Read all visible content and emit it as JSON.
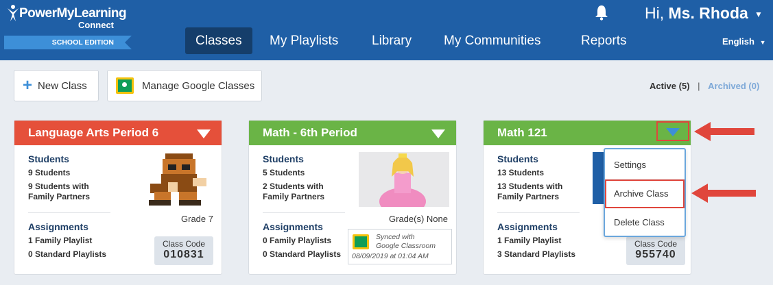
{
  "header": {
    "logo_text": "PowerMyLearning",
    "logo_sub": "Connect",
    "logo_banner": "SCHOOL EDITION",
    "greeting_prefix": "Hi, ",
    "greeting_name": "Ms. Rhoda",
    "language": "English",
    "nav": [
      {
        "label": "Classes",
        "active": true
      },
      {
        "label": "My Playlists"
      },
      {
        "label": "Library"
      },
      {
        "label": "My Communities"
      },
      {
        "label": "Reports"
      }
    ]
  },
  "toolbar": {
    "new_class_label": "New Class",
    "manage_google_label": "Manage Google Classes",
    "filter_active": "Active (5)",
    "filter_sep": "|",
    "filter_archived": "Archived (0)"
  },
  "cards": [
    {
      "title": "Language Arts Period 6",
      "students_heading": "Students",
      "students_count": "9 Students",
      "family_line1": "9 Students with",
      "family_line2": "Family Partners",
      "grade": "Grade 7",
      "assignments_heading": "Assignments",
      "assign1": "1 Family Playlist",
      "assign2": "0 Standard Playlists",
      "code_label": "Class Code",
      "code": "010831"
    },
    {
      "title": "Math - 6th Period",
      "students_heading": "Students",
      "students_count": "5 Students",
      "family_line1": "2 Students with",
      "family_line2": "Family Partners",
      "grade": "Grade(s) None",
      "assignments_heading": "Assignments",
      "assign1": "0 Family Playlists",
      "assign2": "0 Standard Playlists",
      "sync_line1": "Synced with",
      "sync_line2": "Google Classroom",
      "sync_date": "08/09/2019 at 01:04 AM"
    },
    {
      "title": "Math 121",
      "students_heading": "Students",
      "students_count": "13 Students",
      "family_line1": "13 Students with",
      "family_line2": "Family Partners",
      "assignments_heading": "Assignments",
      "assign1": "1 Family Playlist",
      "assign2": "3 Standard Playlists",
      "code_label": "Class Code",
      "code": "955740"
    }
  ],
  "menu": {
    "items": [
      "Settings",
      "Archive Class",
      "Delete Class"
    ]
  },
  "colors": {
    "header_bg": "#1f5fa6",
    "nav_active_bg": "#153e6b",
    "card_red": "#e5503a",
    "card_green": "#6ab446",
    "annotation_red": "#e0463c"
  }
}
